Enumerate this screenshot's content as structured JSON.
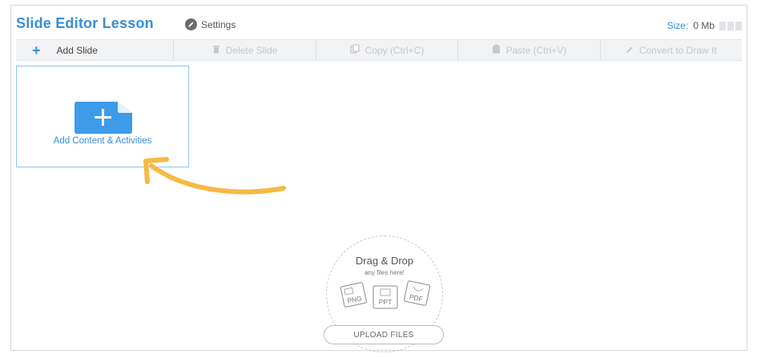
{
  "header": {
    "title": "Slide Editor Lesson",
    "settings_label": "Settings",
    "size_label": "Size:",
    "size_value": "0 Mb"
  },
  "toolbar": {
    "add_slide": "Add Slide",
    "delete_slide": "Delete Slide",
    "copy": "Copy (Ctrl+C)",
    "paste": "Paste (Ctrl+V)",
    "convert": "Convert to Draw It"
  },
  "slide_card": {
    "label": "Add Content & Activities"
  },
  "dropzone": {
    "title": "Drag & Drop",
    "subtitle": "any files here!",
    "file_types": [
      "PNG",
      "PPT",
      "PDF"
    ]
  },
  "upload_button": "UPLOAD FILES",
  "colors": {
    "accent": "#3a8ed0",
    "card_icon": "#3d9be9",
    "arrow": "#f7b942"
  }
}
